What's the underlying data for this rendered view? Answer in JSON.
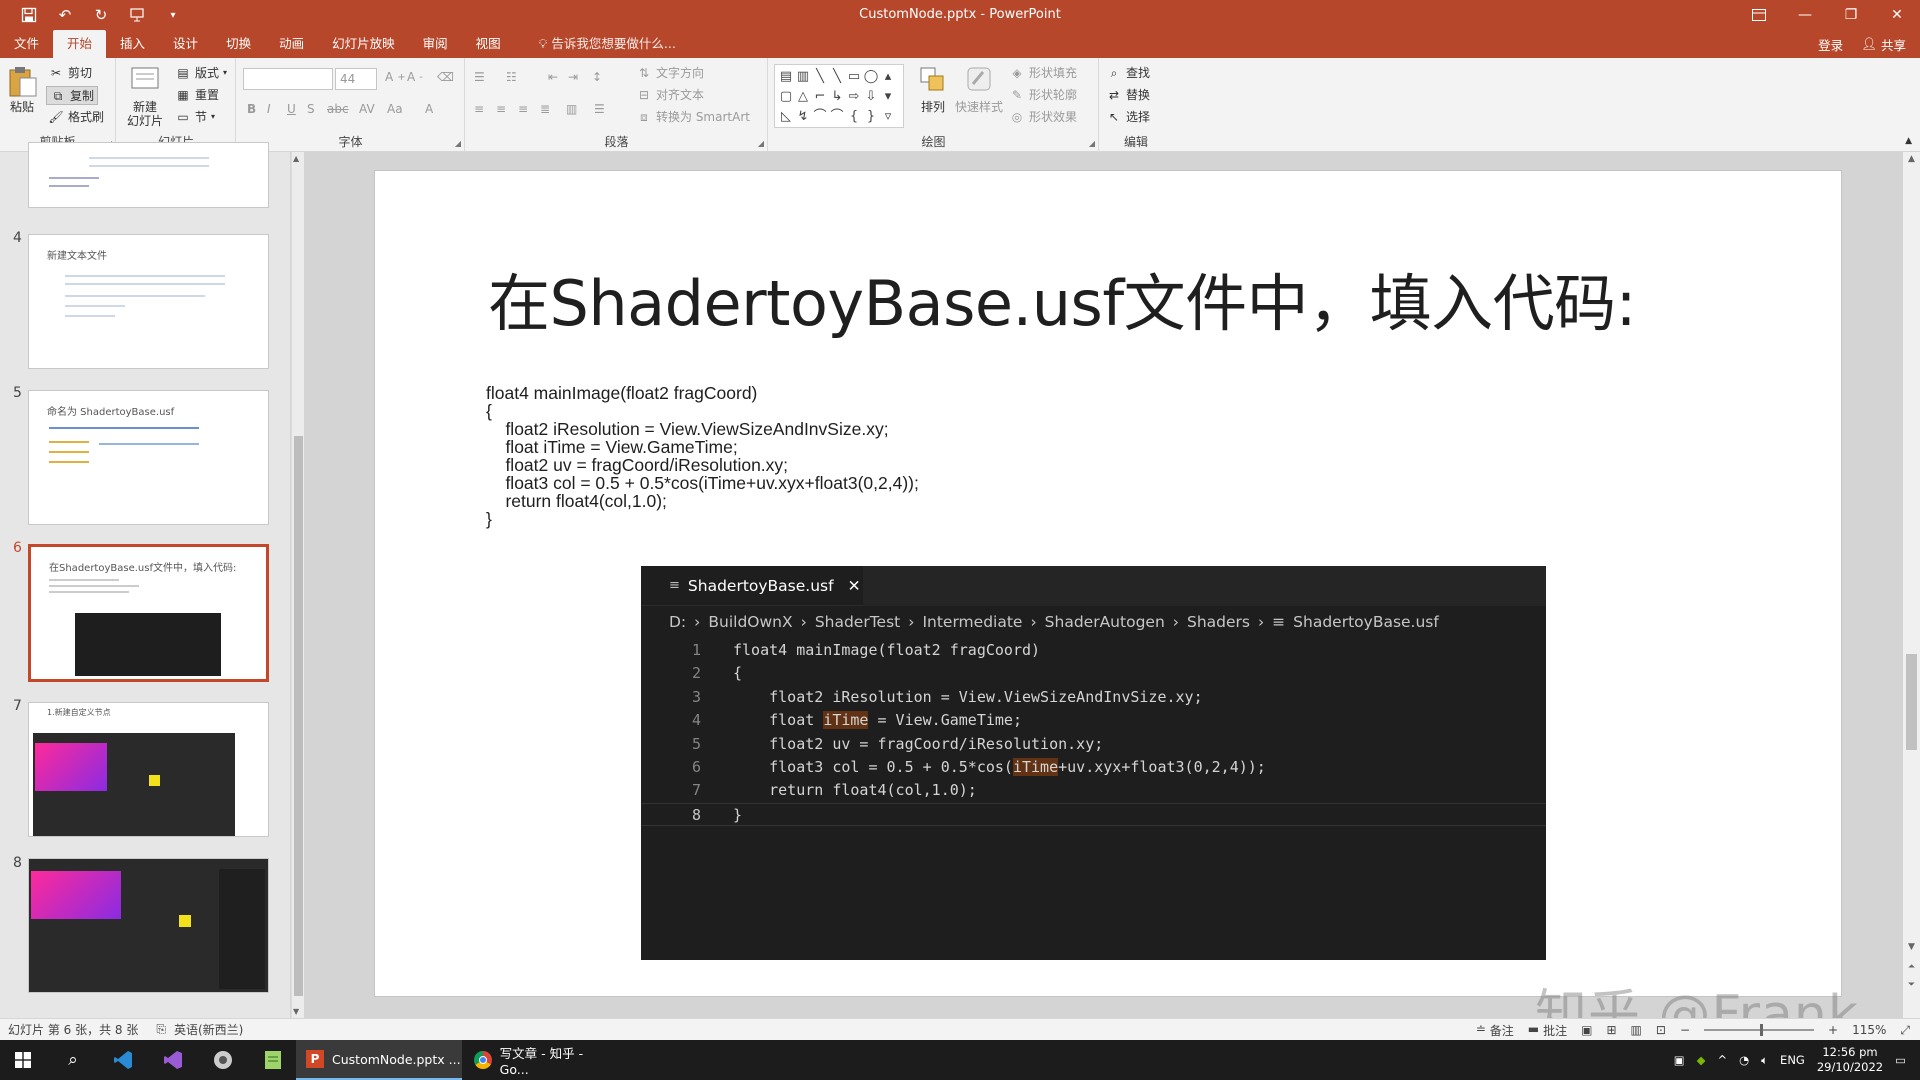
{
  "window": {
    "title": "CustomNode.pptx - PowerPoint"
  },
  "qat": {
    "save_icon": "save-icon",
    "undo_icon": "undo-icon",
    "redo_icon": "redo-icon",
    "present_icon": "present-icon",
    "customize_icon": "chevron-down-icon"
  },
  "tabs": [
    "文件",
    "开始",
    "插入",
    "设计",
    "切换",
    "动画",
    "幻灯片放映",
    "审阅",
    "视图"
  ],
  "active_tab": "开始",
  "tell_me": "告诉我您想要做什么...",
  "account": {
    "login": "登录",
    "share": "共享"
  },
  "ribbon": {
    "clipboard": {
      "label": "剪贴板",
      "paste": "粘贴",
      "cut": "剪切",
      "copy": "复制",
      "format_painter": "格式刷"
    },
    "slides": {
      "label": "幻灯片",
      "new_slide": "新建\n幻灯片",
      "layout": "版式",
      "reset": "重置",
      "section": "节"
    },
    "font": {
      "label": "字体",
      "font_size": "44"
    },
    "paragraph": {
      "label": "段落",
      "text_direction": "文字方向",
      "align_text": "对齐文本",
      "smartart": "转换为 SmartArt"
    },
    "drawing": {
      "label": "绘图",
      "arrange": "排列",
      "quick_styles": "快速样式",
      "shape_fill": "形状填充",
      "shape_outline": "形状轮廓",
      "shape_effects": "形状效果"
    },
    "editing": {
      "label": "编辑",
      "find": "查找",
      "replace": "替换",
      "select": "选择"
    }
  },
  "thumbnails": [
    {
      "num": "4",
      "title": "新建文本文件"
    },
    {
      "num": "5",
      "title": "命名为 ShadertoyBase.usf"
    },
    {
      "num": "6",
      "title": "在ShadertoyBase.usf文件中，填入代码:"
    },
    {
      "num": "7",
      "title": "1.新建自定义节点"
    },
    {
      "num": "8",
      "title": ""
    }
  ],
  "slide": {
    "title": "在ShadertoyBase.usf文件中，填入代码:",
    "code": [
      "float4 mainImage(float2 fragCoord)",
      "{",
      "    float2 iResolution = View.ViewSizeAndInvSize.xy;",
      "    float iTime = View.GameTime;",
      "    float2 uv = fragCoord/iResolution.xy;",
      "    float3 col = 0.5 + 0.5*cos(iTime+uv.xyx+float3(0,2,4));",
      "    return float4(col,1.0);",
      "}"
    ],
    "editor": {
      "tab": "ShadertoyBase.usf",
      "breadcrumb": [
        "D:",
        "BuildOwnX",
        "ShaderTest",
        "Intermediate",
        "ShaderAutogen",
        "Shaders",
        "ShadertoyBase.usf"
      ],
      "line_numbers": [
        "1",
        "2",
        "3",
        "4",
        "5",
        "6",
        "7",
        "8"
      ],
      "lines": [
        "float4 mainImage(float2 fragCoord)",
        "{",
        "    float2 iResolution = View.ViewSizeAndInvSize.xy;",
        "    float iTime = View.GameTime;",
        "    float2 uv = fragCoord/iResolution.xy;",
        "    float3 col = 0.5 + 0.5*cos(iTime+uv.xyx+float3(0,2,4));",
        "    return float4(col,1.0);",
        "}"
      ]
    }
  },
  "status": {
    "slide_info": "幻灯片 第 6 张，共 8 张",
    "language": "英语(新西兰)",
    "notes": "备注",
    "comments": "批注",
    "zoom": "115%"
  },
  "taskbar": {
    "apps": [
      {
        "label": "CustomNode.pptx ...",
        "icon": "powerpoint-icon"
      },
      {
        "label": "写文章 - 知乎 - Go...",
        "icon": "chrome-icon"
      }
    ],
    "lang": "ENG",
    "time": "12:56 pm",
    "date": "29/10/2022"
  },
  "watermark": "知乎 @Frank",
  "colors": {
    "accent": "#b7472a",
    "editor_bg": "#1e1e1e",
    "highlight": "#613214"
  }
}
